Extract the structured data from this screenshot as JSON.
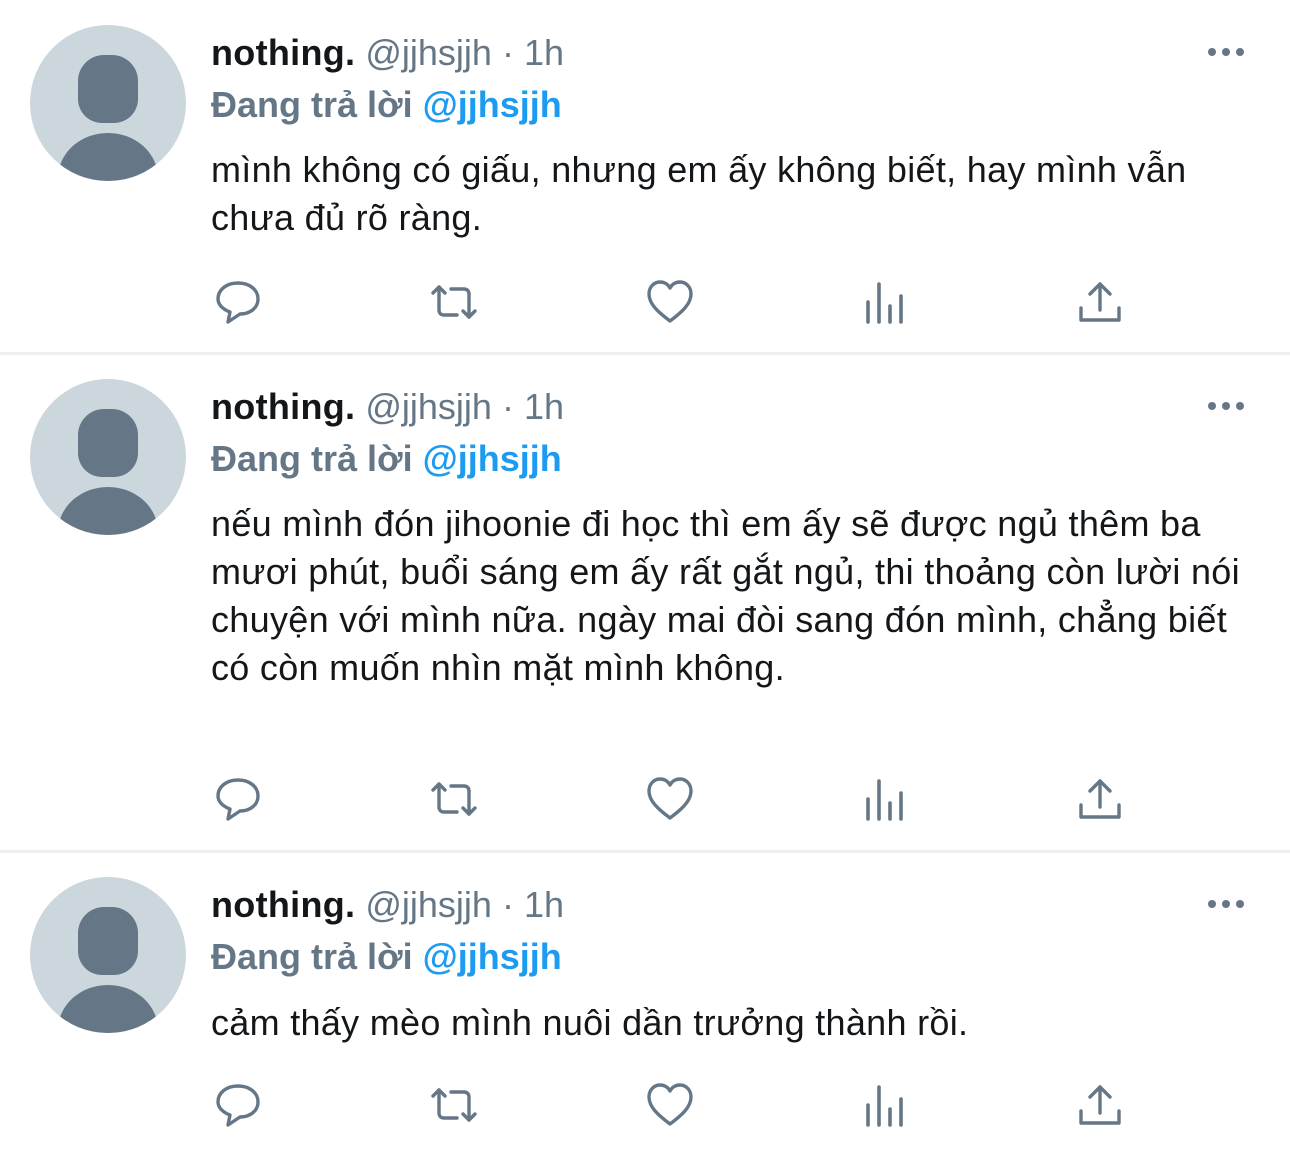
{
  "tweets": [
    {
      "display_name": "nothing.",
      "handle": "@jjhsjjh",
      "separator": "·",
      "time": "1h",
      "reply_prefix": "Đang trả lời",
      "reply_to": "@jjhsjjh",
      "text": "mình không có giấu, nhưng em ấy không biết, hay mình vẫn chưa đủ rõ ràng."
    },
    {
      "display_name": "nothing.",
      "handle": "@jjhsjjh",
      "separator": "·",
      "time": "1h",
      "reply_prefix": "Đang trả lời",
      "reply_to": "@jjhsjjh",
      "text": "nếu mình đón jihoonie đi học thì em ấy sẽ được ngủ thêm ba mươi phút, buổi sáng em ấy rất gắt ngủ, thi thoảng còn lười nói chuyện với mình nữa. ngày mai đòi sang đón mình, chẳng biết có còn muốn nhìn mặt mình không."
    },
    {
      "display_name": "nothing.",
      "handle": "@jjhsjjh",
      "separator": "·",
      "time": "1h",
      "reply_prefix": "Đang trả lời",
      "reply_to": "@jjhsjjh",
      "text": "cảm thấy mèo mình nuôi dần trưởng thành rồi."
    }
  ],
  "icons": {
    "reply": "speech-bubble-icon",
    "retweet": "retweet-arrows-icon",
    "like": "heart-icon",
    "analytics": "bar-chart-icon",
    "share": "share-upload-icon",
    "more": "more-dots-icon"
  },
  "colors": {
    "text": "#14171a",
    "secondary": "#657786",
    "link": "#1d9bf0",
    "avatar_bg": "#ccd6dd",
    "divider": "#eceef0"
  }
}
